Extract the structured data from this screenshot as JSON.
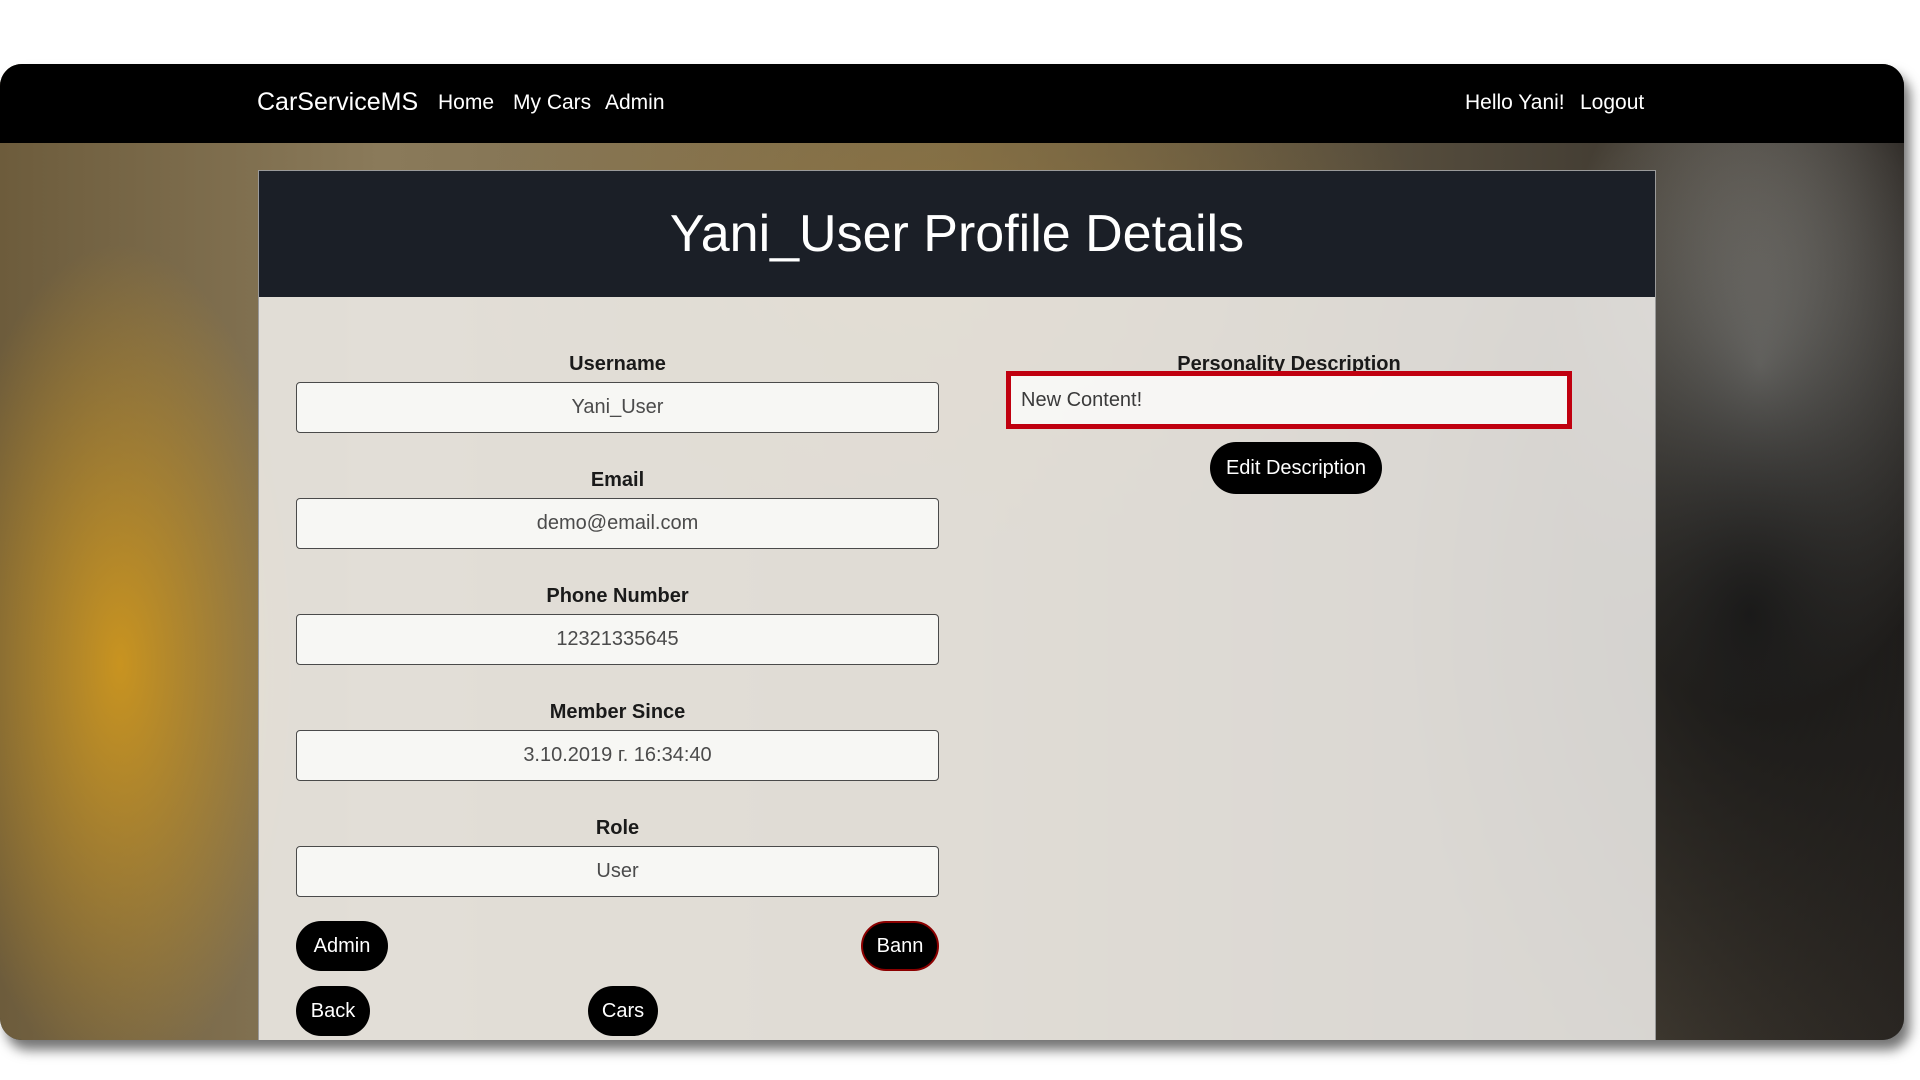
{
  "navbar": {
    "brand": "CarServiceMS",
    "links": [
      "Home",
      "My Cars",
      "Admin"
    ],
    "greeting": "Hello Yani!",
    "logout": "Logout"
  },
  "profile": {
    "title": "Yani_User Profile Details",
    "fields": {
      "username": {
        "label": "Username",
        "value": "Yani_User"
      },
      "email": {
        "label": "Email",
        "value": "demo@email.com"
      },
      "phone": {
        "label": "Phone Number",
        "value": "12321335645"
      },
      "member_since": {
        "label": "Member Since",
        "value": "3.10.2019 г. 16:34:40"
      },
      "role": {
        "label": "Role",
        "value": "User"
      }
    },
    "description": {
      "label": "Personality Description",
      "value": "New Content!",
      "edit_button": "Edit Description"
    },
    "buttons": {
      "admin": "Admin",
      "bann": "Bann",
      "back": "Back",
      "cars": "Cars"
    }
  },
  "colors": {
    "navbar_bg": "#000000",
    "header_bg": "#1b1f27",
    "highlight_border": "#c0000f",
    "button_bg": "#000000",
    "bann_border": "#8b0000"
  }
}
